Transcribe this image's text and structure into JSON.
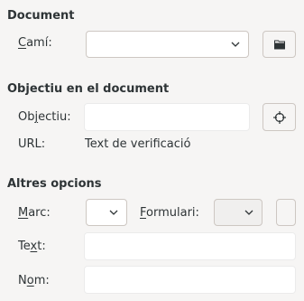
{
  "sections": {
    "document": {
      "title": "Document",
      "path_label_prefix": "",
      "path_label_mnemonic": "C",
      "path_label_rest": "amí:",
      "path_value": ""
    },
    "target": {
      "title": "Objectiu en el document",
      "target_label_prefix": "Ob",
      "target_label_mnemonic": "j",
      "target_label_rest": "ectiu:",
      "target_value": "",
      "url_label": "URL:",
      "url_value": "Text de verificació"
    },
    "other": {
      "title": "Altres opcions",
      "frame_label_prefix": "",
      "frame_label_mnemonic": "M",
      "frame_label_rest": "arc:",
      "frame_value": "",
      "form_label_prefix": "",
      "form_label_mnemonic": "F",
      "form_label_rest": "ormulari:",
      "form_value": "",
      "text_label_prefix": "Te",
      "text_label_mnemonic": "x",
      "text_label_rest": "t:",
      "text_value": "",
      "name_label_prefix": "N",
      "name_label_mnemonic": "o",
      "name_label_rest": "m:",
      "name_value": ""
    }
  },
  "icons": {
    "browse": "folder-icon",
    "target": "crosshair-target-icon",
    "combo": "chevron-down-icon"
  }
}
